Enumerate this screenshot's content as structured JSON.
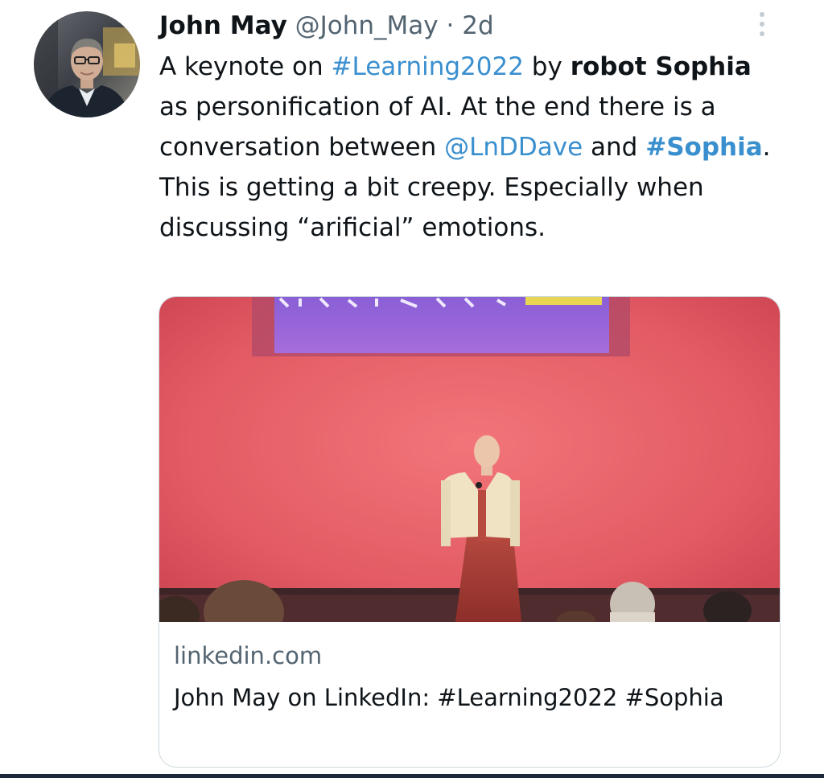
{
  "author": {
    "name": "John May",
    "handle": "@John_May",
    "separator": "·",
    "time": "2d"
  },
  "tweet": {
    "t1": "A keynote on ",
    "hashtag1": "#Learning2022",
    "t2": " by ",
    "bold1": "robot Sophia",
    "t3": " as personification of AI. At the end there is a conversation between ",
    "mention1": "@LnDDave",
    "t4": " and ",
    "hashtag2": "#Sophia",
    "t5": ". This is getting a bit creepy. Especially when discussing “arificial” emotions."
  },
  "card": {
    "domain": "linkedin.com",
    "title": "John May on LinkedIn: #Learning2022 #Sophia",
    "image_icon": "photo-robot-sophia-on-stage"
  },
  "icons": {
    "more": "more-vertical-icon",
    "avatar": "profile-photo"
  },
  "colors": {
    "link": "#3a8fce",
    "text": "#0f1419",
    "secondary": "#536471",
    "border": "#cfd9de"
  }
}
